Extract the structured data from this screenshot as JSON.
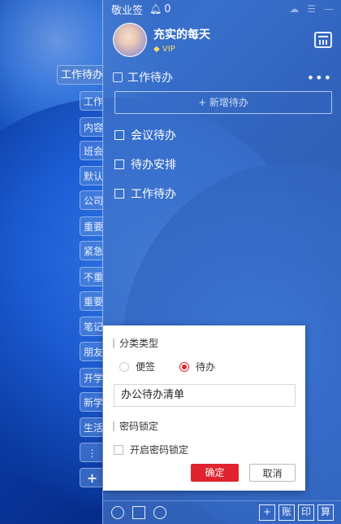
{
  "app": {
    "title": "敬业签",
    "notification_count": "0"
  },
  "user": {
    "name": "充实的每天",
    "badge": "VIP"
  },
  "side_tabs": [
    {
      "label": "工作待办",
      "active": true
    },
    {
      "label": "工作",
      "active": false
    },
    {
      "label": "内容",
      "active": false
    },
    {
      "label": "班会",
      "active": false
    },
    {
      "label": "默认",
      "active": false
    },
    {
      "label": "公司",
      "active": false
    },
    {
      "label": "重要",
      "active": false
    },
    {
      "label": "紧急",
      "active": false
    },
    {
      "label": "不重",
      "active": false
    },
    {
      "label": "重要",
      "active": false
    },
    {
      "label": "笔记",
      "active": false
    },
    {
      "label": "朋友",
      "active": false
    },
    {
      "label": "开学",
      "active": false
    },
    {
      "label": "新学",
      "active": false
    },
    {
      "label": "生活",
      "active": false
    },
    {
      "label": "⋮",
      "active": false
    },
    {
      "label": "+",
      "active": false
    }
  ],
  "section": {
    "title": "工作待办",
    "more": "•••",
    "add_label": "+ 新增待办"
  },
  "todos": [
    "会议待办",
    "待办安排",
    "工作待办"
  ],
  "bottom_right": [
    "+",
    "账",
    "印",
    "算"
  ],
  "dialog": {
    "category_title": "分类类型",
    "option_note": "便签",
    "option_todo": "待办",
    "selected": "待办",
    "name_value": "办公待办清单",
    "lock_title": "密码锁定",
    "lock_label": "开启密码锁定",
    "ok_label": "确定",
    "cancel_label": "取消"
  },
  "colors": {
    "accent": "#e0232e",
    "panel": "#4678c8"
  }
}
